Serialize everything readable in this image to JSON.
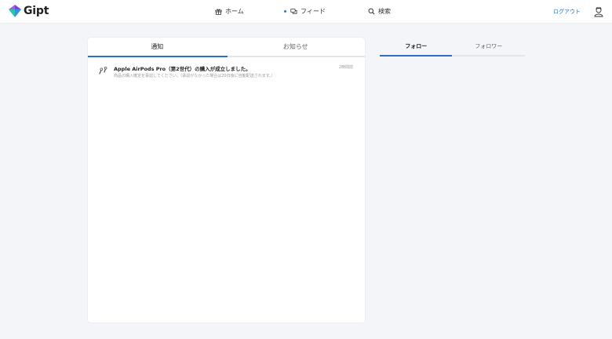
{
  "header": {
    "logo_text": "Gipt",
    "nav": [
      {
        "label": "ホーム",
        "icon": "gift-icon"
      },
      {
        "label": "フィード",
        "icon": "chat-icon"
      },
      {
        "label": "検索",
        "icon": "search-icon"
      }
    ],
    "logout_label": "ログアウト",
    "accent_color": "#2a6fc9"
  },
  "left_panel": {
    "tabs": [
      "通知",
      "お知らせ"
    ],
    "active_tab": "通知",
    "notifications": [
      {
        "title": "Apple AirPods Pro（第2世代）の購入が成立しました。",
        "body": "商品の購入確定を承認してください。（承認がなかった場合は20日後に自動配送されます。）",
        "time": "2時間前"
      }
    ]
  },
  "right_panel": {
    "tabs": [
      "フォロー",
      "フォロワー"
    ],
    "active_tab": "フォロー"
  }
}
